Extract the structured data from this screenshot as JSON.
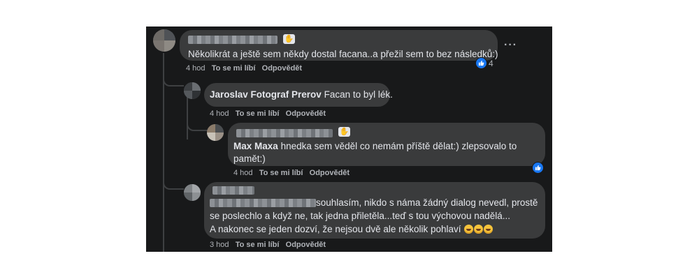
{
  "comments": [
    {
      "text": "Několikrát a ještě sem někdy dostal facana..a přežil sem to bez následků:)",
      "time": "4 hod",
      "like": "To se mi líbí",
      "reply": "Odpovědět",
      "reactions": "4",
      "more": "···"
    },
    {
      "author": "Jaroslav Fotograf Prerov",
      "text": "Facan to byl lék.",
      "time": "4 hod",
      "like": "To se mi líbí",
      "reply": "Odpovědět"
    },
    {
      "mention": "Max Maxa",
      "text1": "hnedka sem věděl co nemám příště dělat:) zlepsovalo to",
      "text2": "pamět:)",
      "time": "4 hod",
      "like": "To se mi líbí",
      "reply": "Odpovědět"
    },
    {
      "line1": "souhlasím, nikdo s náma žádný dialog nevedl, prostě",
      "line2": "se poslechlo a když ne, tak jedna přiletěla...teď s tou výchovou nadělá...",
      "line3": "A nakonec se jeden dozví, že nejsou dvě ale několik pohlaví",
      "time": "3 hod",
      "like": "To se mi líbí",
      "reply": "Odpovědět"
    }
  ],
  "colors": {
    "panel": "#18191a",
    "bubble": "#3a3b3c",
    "text": "#e4e6eb",
    "meta": "#b0b3b8",
    "like": "#1877f2"
  },
  "icons": [
    "like-thumb-icon",
    "more-options-icon",
    "fan-badge-icon",
    "laughing-emoji-icon"
  ]
}
